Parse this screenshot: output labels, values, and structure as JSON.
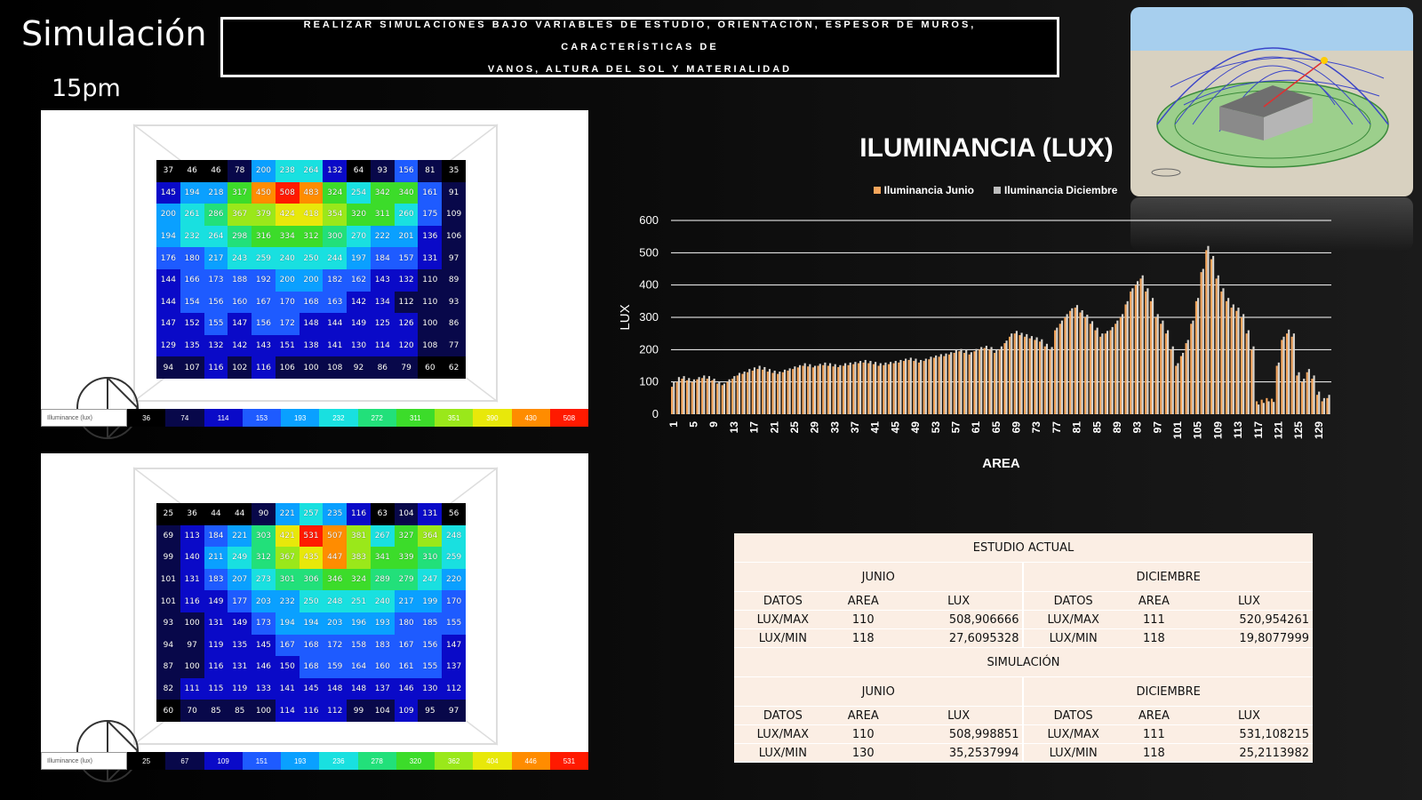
{
  "header": {
    "title": "Simulación",
    "subtitle": "15pm",
    "banner_line1": "REALIZAR SIMULACIONES BAJO VARIABLES DE ESTUDIO, ORIENTACIÓN, ESPESOR DE MUROS, CARACTERÍSTICAS DE",
    "banner_line2": "VANOS, ALTURA DEL SOL Y MATERIALIDAD"
  },
  "heatmap_top": {
    "legend_label": "Illuminance (lux)",
    "legend_values": [
      "36",
      "74",
      "114",
      "153",
      "193",
      "232",
      "272",
      "311",
      "351",
      "390",
      "430",
      "508"
    ],
    "grid": [
      [
        37,
        46,
        46,
        78,
        200,
        238,
        264,
        132,
        64,
        93,
        156,
        81,
        35
      ],
      [
        145,
        194,
        218,
        317,
        450,
        508,
        483,
        324,
        254,
        342,
        340,
        161,
        91
      ],
      [
        200,
        261,
        286,
        367,
        379,
        424,
        418,
        354,
        320,
        311,
        260,
        175,
        109
      ],
      [
        194,
        232,
        264,
        298,
        316,
        334,
        312,
        300,
        270,
        222,
        201,
        136,
        106
      ],
      [
        176,
        180,
        217,
        243,
        259,
        240,
        250,
        244,
        197,
        184,
        157,
        131,
        97
      ],
      [
        144,
        166,
        173,
        188,
        192,
        200,
        200,
        182,
        162,
        143,
        132,
        110,
        89
      ],
      [
        144,
        154,
        156,
        160,
        167,
        170,
        168,
        163,
        142,
        134,
        112,
        110,
        93
      ],
      [
        147,
        152,
        155,
        147,
        156,
        172,
        148,
        144,
        149,
        125,
        126,
        100,
        86
      ],
      [
        129,
        135,
        132,
        142,
        143,
        151,
        138,
        141,
        130,
        114,
        120,
        108,
        77
      ],
      [
        94,
        107,
        116,
        102,
        116,
        106,
        100,
        108,
        92,
        86,
        79,
        60,
        62
      ]
    ]
  },
  "heatmap_bottom": {
    "legend_label": "Illuminance (lux)",
    "legend_values": [
      "25",
      "67",
      "109",
      "151",
      "193",
      "236",
      "278",
      "320",
      "362",
      "404",
      "446",
      "531"
    ],
    "grid": [
      [
        25,
        36,
        44,
        44,
        90,
        221,
        257,
        235,
        116,
        63,
        104,
        131,
        56
      ],
      [
        69,
        113,
        184,
        221,
        303,
        421,
        531,
        507,
        381,
        267,
        327,
        364,
        248
      ],
      [
        99,
        140,
        211,
        249,
        312,
        367,
        435,
        447,
        383,
        341,
        339,
        310,
        259
      ],
      [
        101,
        131,
        183,
        207,
        273,
        301,
        306,
        346,
        324,
        289,
        279,
        247,
        220
      ],
      [
        101,
        116,
        149,
        177,
        203,
        232,
        250,
        248,
        251,
        240,
        217,
        199,
        170
      ],
      [
        93,
        100,
        131,
        149,
        173,
        194,
        194,
        203,
        196,
        193,
        180,
        185,
        155
      ],
      [
        94,
        97,
        119,
        135,
        145,
        167,
        168,
        172,
        158,
        183,
        167,
        156,
        147
      ],
      [
        87,
        100,
        116,
        131,
        146,
        150,
        168,
        159,
        164,
        160,
        161,
        155,
        137
      ],
      [
        82,
        111,
        115,
        119,
        133,
        141,
        145,
        148,
        148,
        137,
        146,
        130,
        112
      ],
      [
        60,
        70,
        85,
        85,
        100,
        114,
        116,
        112,
        99,
        104,
        109,
        95,
        97
      ]
    ]
  },
  "chart_data": {
    "type": "bar",
    "title": "ILUMINANCIA (LUX)",
    "xlabel": "AREA",
    "ylabel": "LUX",
    "ylim": [
      0,
      600
    ],
    "yticks": [
      0,
      100,
      200,
      300,
      400,
      500,
      600
    ],
    "grid": true,
    "legend_position": "top",
    "xtick_labels": [
      "1",
      "5",
      "9",
      "13",
      "17",
      "21",
      "25",
      "29",
      "33",
      "37",
      "41",
      "45",
      "49",
      "53",
      "57",
      "61",
      "65",
      "69",
      "73",
      "77",
      "81",
      "85",
      "89",
      "93",
      "97",
      "101",
      "105",
      "109",
      "113",
      "117",
      "121",
      "125",
      "129"
    ],
    "series": [
      {
        "name": "Iluminancia Junio",
        "color": "#f5a55b",
        "values": [
          85,
          100,
          110,
          105,
          100,
          108,
          112,
          110,
          105,
          95,
          90,
          100,
          110,
          120,
          125,
          130,
          135,
          140,
          138,
          132,
          128,
          125,
          130,
          135,
          140,
          145,
          150,
          148,
          145,
          150,
          152,
          150,
          148,
          146,
          150,
          152,
          155,
          158,
          160,
          158,
          155,
          150,
          152,
          155,
          158,
          160,
          165,
          168,
          165,
          160,
          165,
          170,
          175,
          178,
          180,
          185,
          190,
          195,
          190,
          185,
          195,
          200,
          205,
          200,
          190,
          200,
          220,
          240,
          250,
          245,
          240,
          235,
          230,
          225,
          210,
          200,
          260,
          280,
          300,
          320,
          330,
          315,
          300,
          280,
          260,
          240,
          250,
          260,
          280,
          300,
          340,
          380,
          400,
          420,
          380,
          350,
          300,
          280,
          250,
          200,
          150,
          180,
          220,
          280,
          350,
          440,
          508,
          480,
          420,
          380,
          350,
          330,
          320,
          300,
          250,
          200,
          40,
          45,
          50,
          48,
          150,
          230,
          250,
          240,
          120,
          100,
          130,
          110,
          60,
          40,
          50
        ]
      },
      {
        "name": "Iluminancia Diciembre",
        "color": "#d9d5cf",
        "values": [
          100,
          115,
          118,
          112,
          108,
          115,
          120,
          118,
          110,
          102,
          95,
          108,
          118,
          128,
          132,
          140,
          145,
          150,
          146,
          140,
          135,
          132,
          138,
          142,
          148,
          152,
          158,
          155,
          150,
          156,
          160,
          158,
          155,
          152,
          158,
          160,
          162,
          165,
          168,
          165,
          162,
          158,
          160,
          162,
          165,
          168,
          172,
          175,
          172,
          168,
          172,
          178,
          182,
          186,
          188,
          192,
          198,
          202,
          198,
          192,
          202,
          208,
          212,
          208,
          198,
          210,
          228,
          250,
          258,
          252,
          248,
          242,
          238,
          232,
          218,
          208,
          268,
          290,
          310,
          328,
          338,
          322,
          308,
          288,
          268,
          250,
          258,
          270,
          290,
          310,
          350,
          390,
          412,
          430,
          390,
          360,
          310,
          290,
          260,
          210,
          158,
          190,
          230,
          290,
          360,
          450,
          521,
          490,
          430,
          390,
          360,
          340,
          330,
          310,
          260,
          210,
          30,
          35,
          40,
          38,
          160,
          240,
          262,
          250,
          130,
          110,
          140,
          120,
          70,
          50,
          60
        ]
      }
    ]
  },
  "table": {
    "title1": "ESTUDIO ACTUAL",
    "title2": "SIMULACIÓN",
    "junio": "JUNIO",
    "diciembre": "DICIEMBRE",
    "h_datos": "DATOS",
    "h_area": "AREA",
    "h_lux": "LUX",
    "actual": [
      [
        "LUX/MAX",
        "110",
        "508,906666",
        "LUX/MAX",
        "111",
        "520,954261"
      ],
      [
        "LUX/MIN",
        "118",
        "27,6095328",
        "LUX/MIN",
        "118",
        "19,8077999"
      ]
    ],
    "sim": [
      [
        "LUX/MAX",
        "110",
        "508,998851",
        "LUX/MAX",
        "111",
        "531,108215"
      ],
      [
        "LUX/MIN",
        "130",
        "35,2537994",
        "LUX/MIN",
        "118",
        "25,2113982"
      ]
    ]
  }
}
